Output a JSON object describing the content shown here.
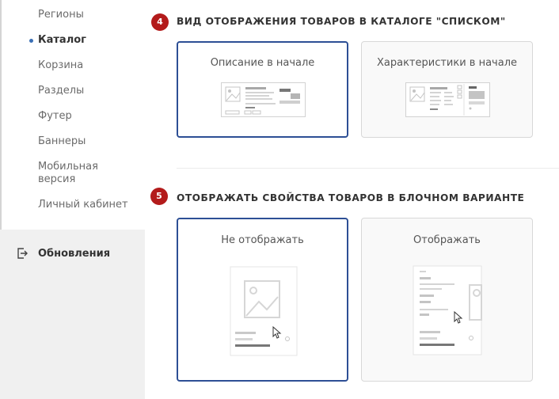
{
  "sidebar": {
    "items": [
      {
        "label": "Регионы",
        "active": false
      },
      {
        "label": "Каталог",
        "active": true
      },
      {
        "label": "Корзина",
        "active": false
      },
      {
        "label": "Разделы",
        "active": false
      },
      {
        "label": "Футер",
        "active": false
      },
      {
        "label": "Баннеры",
        "active": false
      },
      {
        "label": "Мобильная версия",
        "active": false
      },
      {
        "label": "Личный кабинет",
        "active": false
      }
    ],
    "updates_label": "Обновления",
    "updates_icon": "exit-door-icon"
  },
  "sections": [
    {
      "number": "4",
      "title": "ВИД ОТОБРАЖЕНИЯ ТОВАРОВ В КАТАЛОГЕ \"СПИСКОМ\"",
      "options": [
        {
          "label": "Описание в начале",
          "selected": true
        },
        {
          "label": "Характеристики в начале",
          "selected": false
        }
      ]
    },
    {
      "number": "5",
      "title": "ОТОБРАЖАТЬ СВОЙСТВА ТОВАРОВ В БЛОЧНОМ ВАРИАНТЕ",
      "options": [
        {
          "label": "Не отображать",
          "selected": true
        },
        {
          "label": "Отображать",
          "selected": false
        }
      ]
    }
  ],
  "colors": {
    "accent": "#2d4f95",
    "badge": "#b31b1b",
    "active_dot": "#3a6fb5"
  }
}
